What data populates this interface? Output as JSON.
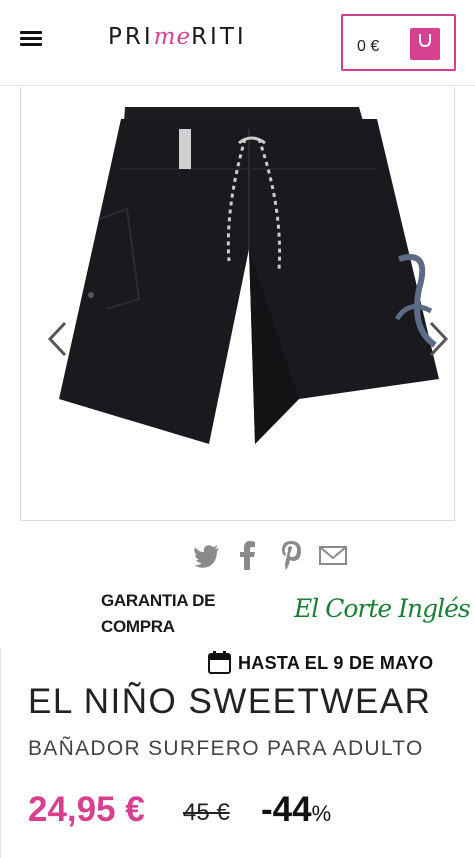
{
  "header": {
    "logo_start": "PRI",
    "logo_accent": "me",
    "logo_end": "RITI",
    "cart_amount": "0 €"
  },
  "gallery": {
    "image_subject": "black board shorts",
    "prev_icon": "chevron-left-icon",
    "next_icon": "chevron-right-icon"
  },
  "share": {
    "icons": [
      "twitter-icon",
      "facebook-icon",
      "pinterest-icon",
      "email-icon"
    ]
  },
  "guarantee": {
    "text": "GARANTIA DE COMPRA",
    "partner_logo": "El Corte Inglés"
  },
  "offer": {
    "text": "HASTA EL 9 DE MAYO"
  },
  "product": {
    "brand": "EL NIÑO SWEETWEAR",
    "subtitle": "BAÑADOR SURFERO PARA ADULTO",
    "price": "24,95 €",
    "old_price": "45 €",
    "discount": "-44",
    "discount_unit": "%"
  },
  "colors": {
    "accent": "#d6418f",
    "brand_green": "#1a7f33"
  }
}
